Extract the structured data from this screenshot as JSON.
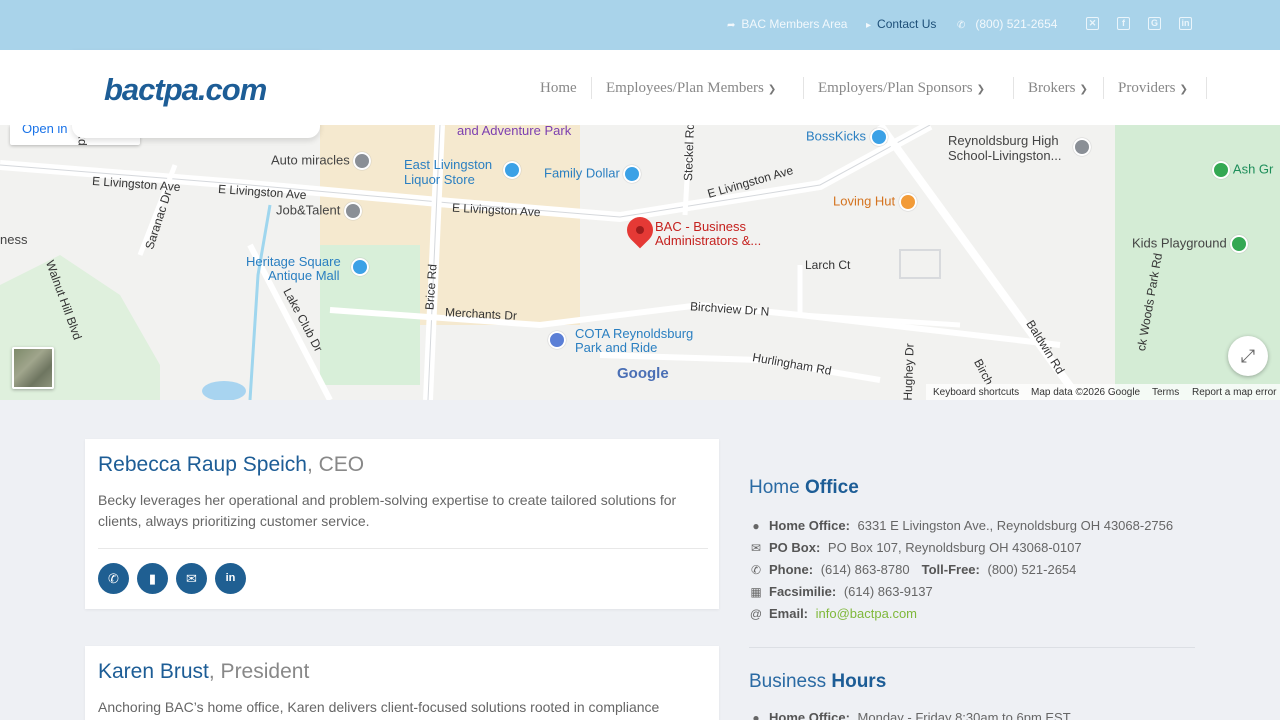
{
  "topbar": {
    "members_label": "BAC Members Area",
    "contact_label": "Contact Us",
    "phone_label": "(800) 521-2654",
    "social_icons": [
      "x-icon",
      "facebook-icon",
      "google-icon",
      "linkedin-icon"
    ]
  },
  "header": {
    "logo_text": "bactpa.com",
    "nav": [
      {
        "label": "Home",
        "has_dropdown": false
      },
      {
        "label": "Employees/Plan Members",
        "has_dropdown": true
      },
      {
        "label": "Employers/Plan Sponsors",
        "has_dropdown": true
      },
      {
        "label": "Brokers",
        "has_dropdown": true
      },
      {
        "label": "Providers",
        "has_dropdown": true
      }
    ]
  },
  "map": {
    "open_in_label": "Open in",
    "pin_label_1": "BAC - Business",
    "pin_label_2": "Administrators &...",
    "labels": {
      "auto_miracles": "Auto miracles",
      "east_livingston_liquor_1": "East Livingston",
      "east_livingston_liquor_2": "Liquor Store",
      "family_dollar": "Family Dollar",
      "bosskicks": "BossKicks",
      "reynoldsburg_high_1": "Reynoldsburg High",
      "reynoldsburg_high_2": "School-Livingston...",
      "ash_gr": "Ash Gr",
      "job_talent": "Job&Talent",
      "loving_hut": "Loving Hut",
      "heritage_1": "Heritage Square",
      "heritage_2": "Antique Mall",
      "kids_playground": "Kids Playground",
      "cota_1": "COTA Reynoldsburg",
      "cota_2": "Park and Ride",
      "adventure_park": "and Adventure Park",
      "ness": "ness"
    },
    "roads": {
      "e_livingston_1": "E Livingston Ave",
      "e_livingston_2": "E Livingston Ave",
      "e_livingston_3": "E Livingston Ave",
      "e_livingston_4": "E Livingston Ave",
      "saranac": "Saranac Dr",
      "walnut_hill": "Walnut Hill Blvd",
      "lake_club": "Lake Club Dr",
      "brice": "Brice Rd",
      "merchants": "Merchants Dr",
      "steckel": "Steckel Rd",
      "larch": "Larch Ct",
      "birchview": "Birchview Dr N",
      "hurlingham": "Hurlingham Rd",
      "hughey": "Hughey Dr",
      "baldwin": "Baldwin Rd",
      "birch": "Birch",
      "woods_park": "ck Woods Park Rd",
      "rd_left": "Rd"
    },
    "google_label": "Google",
    "footer": {
      "keyboard": "Keyboard shortcuts",
      "mapdata": "Map data ©2026 Google",
      "terms": "Terms",
      "report": "Report a map error"
    }
  },
  "people": [
    {
      "name": "Rebecca Raup Speich",
      "role": ", CEO",
      "description": "Becky leverages her operational and problem-solving expertise to create tailored solutions for clients, always prioritizing customer service."
    },
    {
      "name": "Karen Brust",
      "role": ", President",
      "description": "Anchoring BAC’s home office, Karen delivers client-focused solutions rooted in compliance"
    }
  ],
  "home_office": {
    "heading_light": "Home ",
    "heading_bold": "Office",
    "address_key": "Home Office:",
    "address_val": "6331 E Livingston Ave., Reynoldsburg OH 43068-2756",
    "pobox_key": "PO Box:",
    "pobox_val": "PO Box 107, Reynoldsburg OH 43068-0107",
    "phone_key": "Phone:",
    "phone_val": "(614) 863-8780",
    "tollfree_key": "Toll-Free:",
    "tollfree_val": "(800) 521-2654",
    "fax_key": "Facsimilie:",
    "fax_val": "(614) 863-9137",
    "email_key": "Email:",
    "email_val": "info@bactpa.com"
  },
  "business_hours": {
    "heading_light": "Business ",
    "heading_bold": "Hours",
    "row_key": "Home Office:",
    "row_val": "Monday - Friday 8:30am to 6pm EST"
  },
  "colors": {
    "topbar_bg": "#a9d3ea",
    "brand_blue": "#1d5d96",
    "email_link": "#7fb83a",
    "page_bg": "#eef0f4"
  }
}
